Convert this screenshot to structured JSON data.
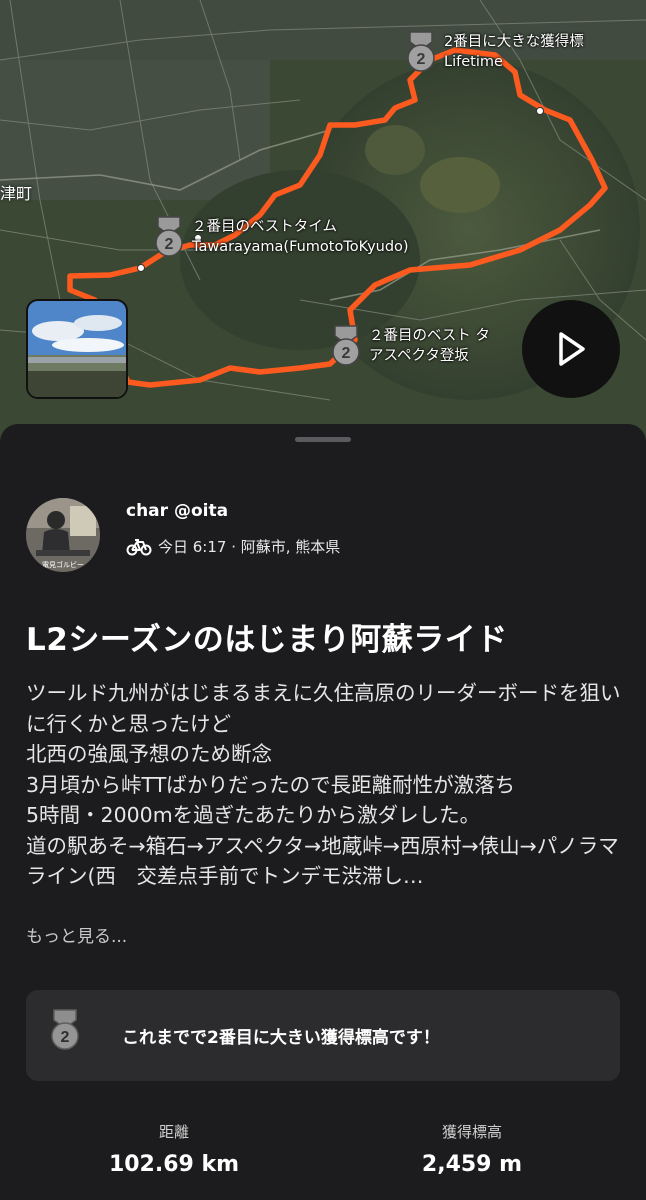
{
  "map": {
    "town_label": "津町",
    "markers": [
      {
        "rank": "2",
        "line1": "2番目に大きな獲得標",
        "line2": "Lifetime"
      },
      {
        "rank": "2",
        "line1": "２番目のベストタイム",
        "line2": "Tawarayama(FumotoToKyudo)"
      },
      {
        "rank": "2",
        "line1": "２番目のベスト タ",
        "line2": "アスペクタ登坂"
      }
    ],
    "route_color": "#fc5a1f",
    "play_icon": "play-icon"
  },
  "activity": {
    "author": "char @oita",
    "sport_icon": "bike-icon",
    "meta": "今日 6:17 · 阿蘇市, 熊本県",
    "avatar_caption": "電見ゴルビー",
    "title": "L2シーズンのはじまり阿蘇ライド",
    "description": "ツールド九州がはじまるまえに久住高原のリーダーボードを狙いに行くかと思ったけど\n北西の強風予想のため断念\n3月頃から峠TTばかりだったので長距離耐性が激落ち\n5時間・2000mを過ぎたあたりから激ダレした。\n道の駅あそ→箱石→アスペクタ→地蔵峠→西原村→俵山→パノラマライン(西　交差点手前でトンデモ渋滞し…",
    "more": "もっと見る...",
    "achievement": "これまでで2番目に大きい獲得標高です！",
    "achievement_rank": "2",
    "stats": [
      {
        "label": "距離",
        "value": "102.69 km"
      },
      {
        "label": "獲得標高",
        "value": "2,459 m"
      }
    ]
  }
}
